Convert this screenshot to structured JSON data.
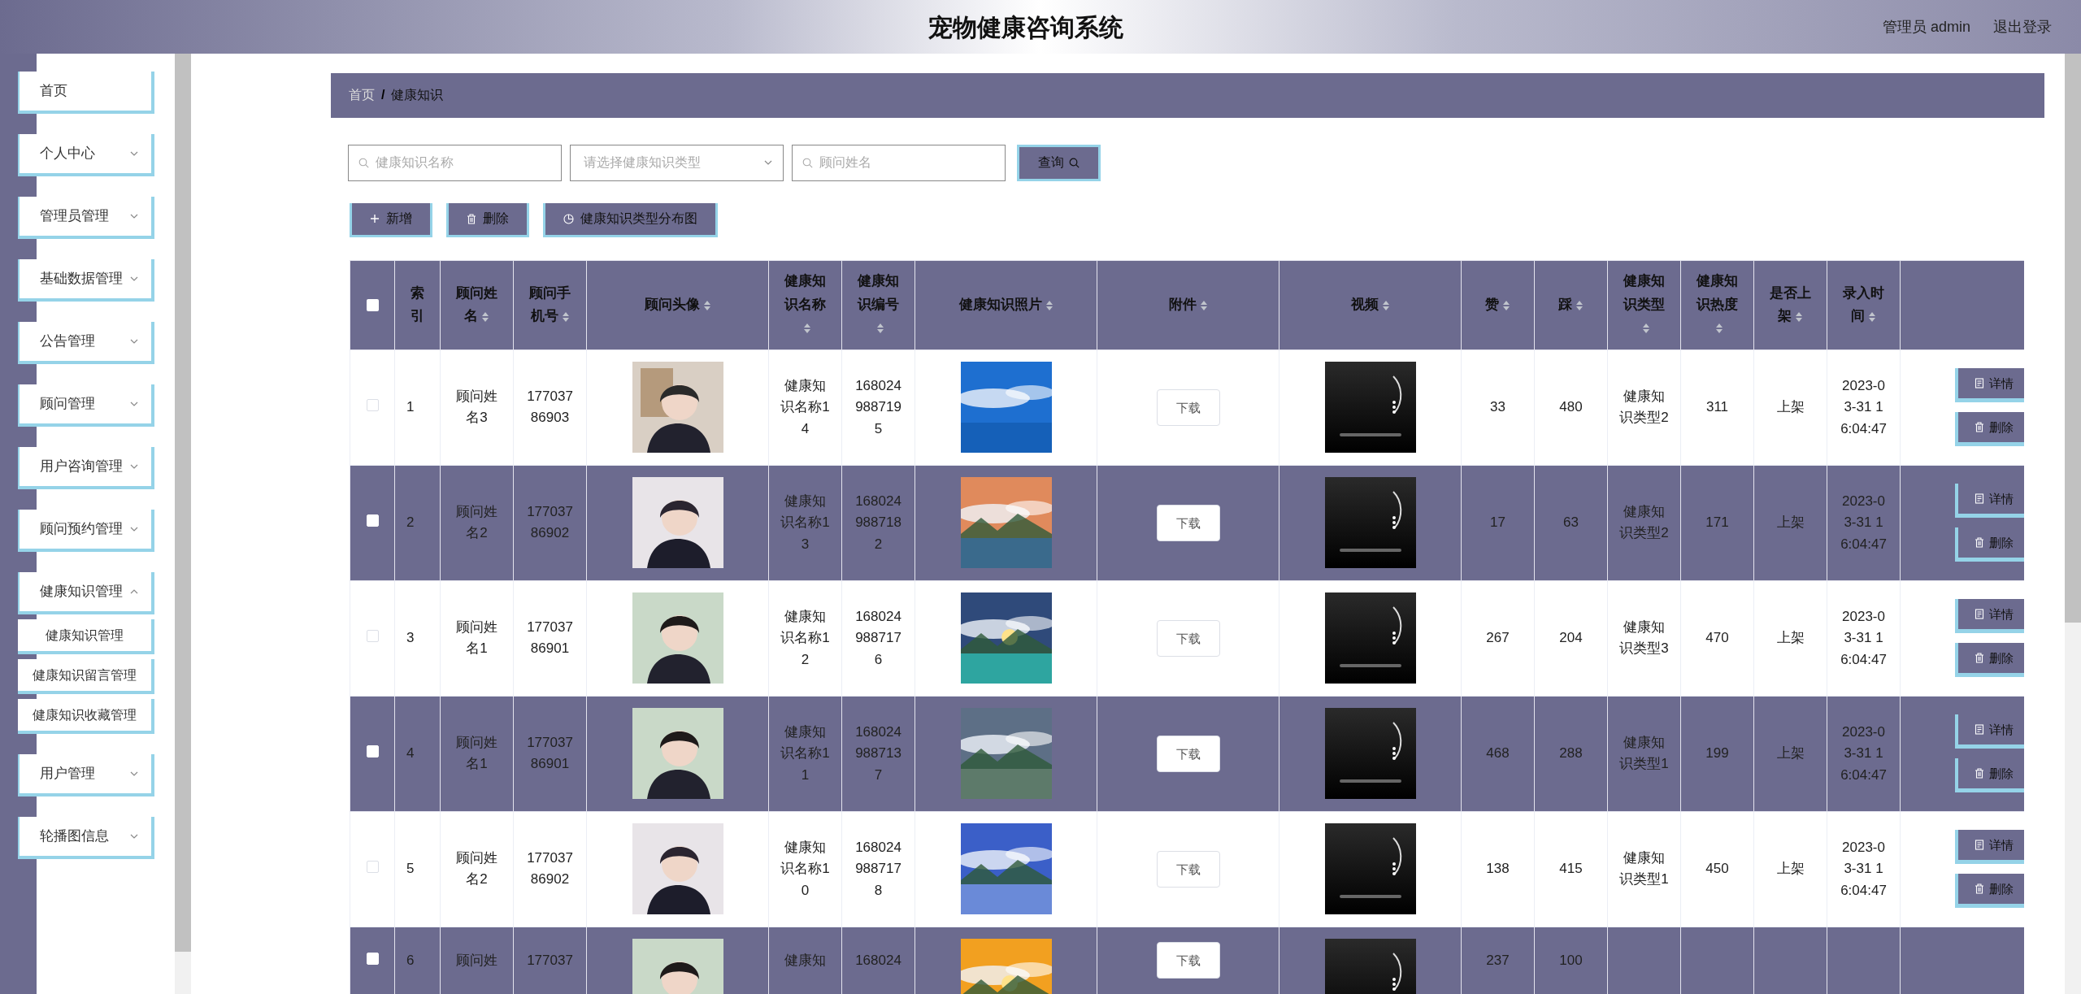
{
  "header": {
    "title": "宠物健康咨询系统",
    "user": "管理员 admin",
    "logout": "退出登录"
  },
  "sidebar": {
    "items": [
      {
        "label": "首页",
        "kind": "link"
      },
      {
        "label": "个人中心",
        "kind": "menu",
        "expanded": false
      },
      {
        "label": "管理员管理",
        "kind": "menu",
        "expanded": false
      },
      {
        "label": "基础数据管理",
        "kind": "menu",
        "expanded": false
      },
      {
        "label": "公告管理",
        "kind": "menu",
        "expanded": false
      },
      {
        "label": "顾问管理",
        "kind": "menu",
        "expanded": false
      },
      {
        "label": "用户咨询管理",
        "kind": "menu",
        "expanded": false
      },
      {
        "label": "顾问预约管理",
        "kind": "menu",
        "expanded": false
      },
      {
        "label": "健康知识管理",
        "kind": "menu",
        "expanded": true,
        "children": [
          {
            "label": "健康知识管理"
          },
          {
            "label": "健康知识留言管理"
          },
          {
            "label": "健康知识收藏管理"
          }
        ]
      },
      {
        "label": "用户管理",
        "kind": "menu",
        "expanded": false
      },
      {
        "label": "轮播图信息",
        "kind": "menu",
        "expanded": false
      }
    ]
  },
  "breadcrumb": [
    "首页",
    "/",
    "健康知识"
  ],
  "search": {
    "fields": [
      {
        "kind": "text",
        "placeholder": "健康知识名称"
      },
      {
        "kind": "select",
        "placeholder": "请选择健康知识类型"
      },
      {
        "kind": "text",
        "placeholder": "顾问姓名"
      }
    ],
    "button": "查询"
  },
  "toolbar": [
    {
      "label": "新增"
    },
    {
      "label": "删除"
    },
    {
      "label": "健康知识类型分布图"
    }
  ],
  "table": {
    "header_checked": false,
    "columns": [
      {
        "kind": "checkbox"
      },
      {
        "kind": "index",
        "label": "索引",
        "sortable": false
      },
      {
        "kind": "text",
        "label": "顾问姓名",
        "sortable": true
      },
      {
        "kind": "text",
        "label": "顾问手机号",
        "sortable": true
      },
      {
        "kind": "avatar",
        "label": "顾问头像",
        "sortable": true
      },
      {
        "kind": "text",
        "label": "健康知识名称",
        "sortable": true
      },
      {
        "kind": "text",
        "label": "健康知识编号",
        "sortable": true
      },
      {
        "label": "健康知识照片",
        "sortable": true
      },
      {
        "kind": "file",
        "label": "附件",
        "sortable": true
      },
      {
        "kind": "video",
        "label": "视频",
        "sortable": true
      },
      {
        "kind": "text",
        "label": "赞",
        "sortable": true
      },
      {
        "kind": "text",
        "label": "踩",
        "sortable": true
      },
      {
        "kind": "text",
        "label": "健康知识类型",
        "sortable": true
      },
      {
        "kind": "text",
        "label": "健康知识热度",
        "sortable": true
      },
      {
        "kind": "text",
        "label": "是否上架",
        "sortable": true
      },
      {
        "kind": "text",
        "label": "录入时间",
        "sortable": true
      },
      {
        "kind": "actions"
      }
    ],
    "rows": [
      {
        "checked": false,
        "cells": [
          null,
          "1",
          "顾问姓名3",
          "17703786903",
          {
            "kind": "picture"
          },
          "健康知识名称14",
          "1680249887195",
          {
            "kind": "picture"
          },
          "下载",
          {
            "kind": "picture"
          },
          "33",
          "480",
          "健康知识类型2",
          "311",
          "上架",
          "2023-03-31 16:04:47",
          [
            "详情",
            "删除"
          ]
        ]
      },
      {
        "checked": false,
        "cells": [
          null,
          "2",
          "顾问姓名2",
          "17703786902",
          {
            "kind": "picture"
          },
          "健康知识名称13",
          "1680249887182",
          {
            "kind": "picture"
          },
          "下载",
          {
            "kind": "picture"
          },
          "17",
          "63",
          "健康知识类型2",
          "171",
          "上架",
          "2023-03-31 16:04:47",
          [
            "详情",
            "删除"
          ]
        ]
      },
      {
        "checked": false,
        "cells": [
          null,
          "3",
          "顾问姓名1",
          "17703786901",
          {
            "kind": "picture"
          },
          "健康知识名称12",
          "1680249887176",
          {
            "kind": "picture"
          },
          "下载",
          {
            "kind": "picture"
          },
          "267",
          "204",
          "健康知识类型3",
          "470",
          "上架",
          "2023-03-31 16:04:47",
          [
            "详情",
            "删除"
          ]
        ]
      },
      {
        "checked": false,
        "cells": [
          null,
          "4",
          "顾问姓名1",
          "17703786901",
          {
            "kind": "picture"
          },
          "健康知识名称11",
          "1680249887137",
          {
            "kind": "picture"
          },
          "下载",
          {
            "kind": "picture"
          },
          "468",
          "288",
          "健康知识类型1",
          "199",
          "上架",
          "2023-03-31 16:04:47",
          [
            "详情",
            "删除"
          ]
        ]
      },
      {
        "checked": false,
        "cells": [
          null,
          "5",
          "顾问姓名2",
          "17703786902",
          {
            "kind": "picture"
          },
          "健康知识名称10",
          "1680249887178",
          {
            "kind": "picture"
          },
          "下载",
          {
            "kind": "picture"
          },
          "138",
          "415",
          "健康知识类型1",
          "450",
          "上架",
          "2023-03-31 16:04:47",
          [
            "详情",
            "删除"
          ]
        ]
      },
      {
        "checked": false,
        "cells": [
          null,
          "6",
          "顾问姓",
          "177037",
          {
            "kind": "picture"
          },
          "健康知",
          "168024",
          {
            "kind": "picture"
          },
          "下载",
          {
            "kind": "picture"
          },
          "237",
          "100"
        ],
        "partial": true
      }
    ]
  }
}
